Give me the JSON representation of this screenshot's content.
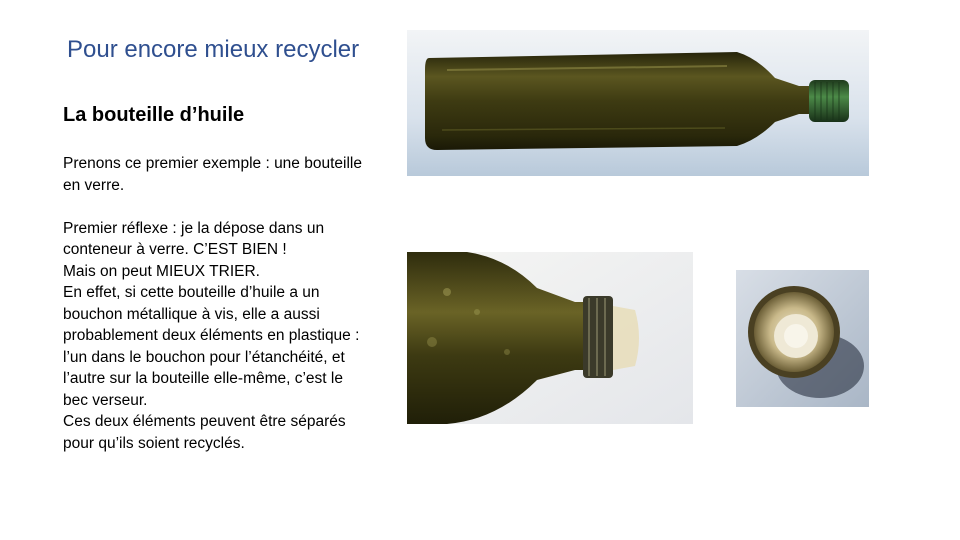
{
  "slide": {
    "title": "Pour encore mieux recycler",
    "subtitle": "La bouteille d’huile",
    "paragraphs": [
      "Prenons ce premier exemple : une bouteille en verre.",
      "",
      "Premier réflexe : je la dépose dans un conteneur à verre. C’EST BIEN !",
      "Mais on peut MIEUX TRIER.",
      "En effet, si cette bouteille d’huile a un bouchon métallique à vis, elle a aussi probablement deux éléments en plastique : l’un dans le bouchon pour l’étanchéité, et l’autre sur la bouteille elle-même, c’est le bec verseur.",
      "Ces deux éléments peuvent être séparés pour qu’ils soient recyclés."
    ]
  },
  "photos": [
    {
      "name": "olive-oil-bottle-photo",
      "subject": "green glass oil bottle lying on its side with green screw cap"
    },
    {
      "name": "bottle-neck-pourer-photo",
      "subject": "bottle neck with plastic pouring spout"
    },
    {
      "name": "cap-inside-photo",
      "subject": "inside of metal cap showing plastic seal"
    }
  ],
  "colors": {
    "title": "#2f4f8f",
    "glass": "#3d3a12",
    "cap": "#2f5a2e",
    "background_photo": "#dfe6ee"
  }
}
